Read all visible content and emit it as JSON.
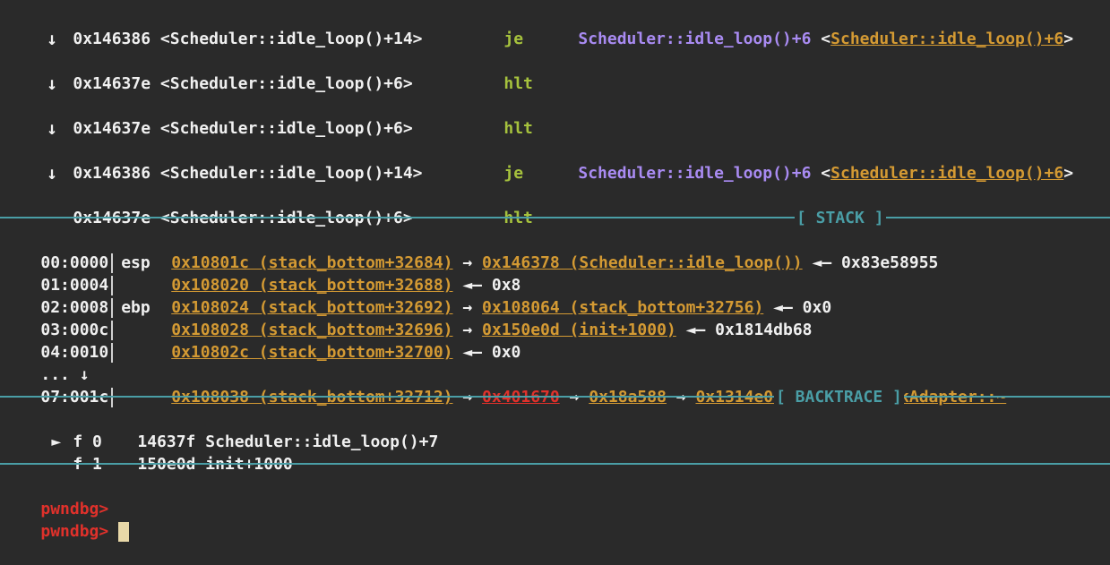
{
  "disasm": [
    {
      "addr": "0x146386",
      "sym": "<Scheduler::idle_loop()+14>",
      "mnem": "je",
      "target": "Scheduler::idle_loop()+6",
      "link": "Scheduler::idle_loop()+6"
    },
    {
      "addr": "0x14637e",
      "sym": "<Scheduler::idle_loop()+6>",
      "mnem": "hlt",
      "target": "",
      "link": ""
    },
    {
      "addr": "0x14637e",
      "sym": "<Scheduler::idle_loop()+6>",
      "mnem": "hlt",
      "target": "",
      "link": ""
    },
    {
      "addr": "0x146386",
      "sym": "<Scheduler::idle_loop()+14>",
      "mnem": "je",
      "target": "Scheduler::idle_loop()+6",
      "link": "Scheduler::idle_loop()+6"
    },
    {
      "addr": "0x14637e",
      "sym": "<Scheduler::idle_loop()+6>",
      "mnem": "hlt",
      "target": "",
      "link": ""
    }
  ],
  "arrow_glyph": "↓",
  "stack_title": "[ STACK ]",
  "stack": [
    {
      "idx": "00:0000",
      "reg": "esp",
      "a": "0x10801c (stack_bottom+32684)",
      "b": "0x146378 (Scheduler::idle_loop())",
      "c": "0x83e58955"
    },
    {
      "idx": "01:0004",
      "reg": "",
      "a": "0x108020 (stack_bottom+32688)",
      "b": "",
      "c": "0x8"
    },
    {
      "idx": "02:0008",
      "reg": "ebp",
      "a": "0x108024 (stack_bottom+32692)",
      "b": "0x108064 (stack_bottom+32756)",
      "c": "0x0"
    },
    {
      "idx": "03:000c",
      "reg": "",
      "a": "0x108028 (stack_bottom+32696)",
      "b": "0x150e0d (init+1000)",
      "c": "0x1814db68"
    },
    {
      "idx": "04:0010",
      "reg": "",
      "a": "0x10802c (stack_bottom+32700)",
      "b": "",
      "c": "0x0"
    }
  ],
  "stack_ellipsis": "...",
  "stack_last": {
    "idx": "07:001c",
    "a": "0x108038 (stack_bottom+32712)",
    "b": "0x401670",
    "c": "0x18a588",
    "d": "0x1314e0 (E1000NetworkAdapter::~"
  },
  "backtrace_title": "[ BACKTRACE ]",
  "backtrace": [
    {
      "marker": "►",
      "frame": "f 0",
      "addr": "14637f",
      "sym": "Scheduler::idle_loop()+7"
    },
    {
      "marker": "",
      "frame": "f 1",
      "addr": "150e0d",
      "sym": "init+1000"
    }
  ],
  "prompt": "pwndbg>",
  "colors": {
    "bg": "#2a2a2a",
    "mnemonic": "#a6c23d",
    "target": "#a98bf2",
    "link": "#d49a33",
    "separator": "#4a9ea6",
    "prompt": "#e0312b"
  }
}
